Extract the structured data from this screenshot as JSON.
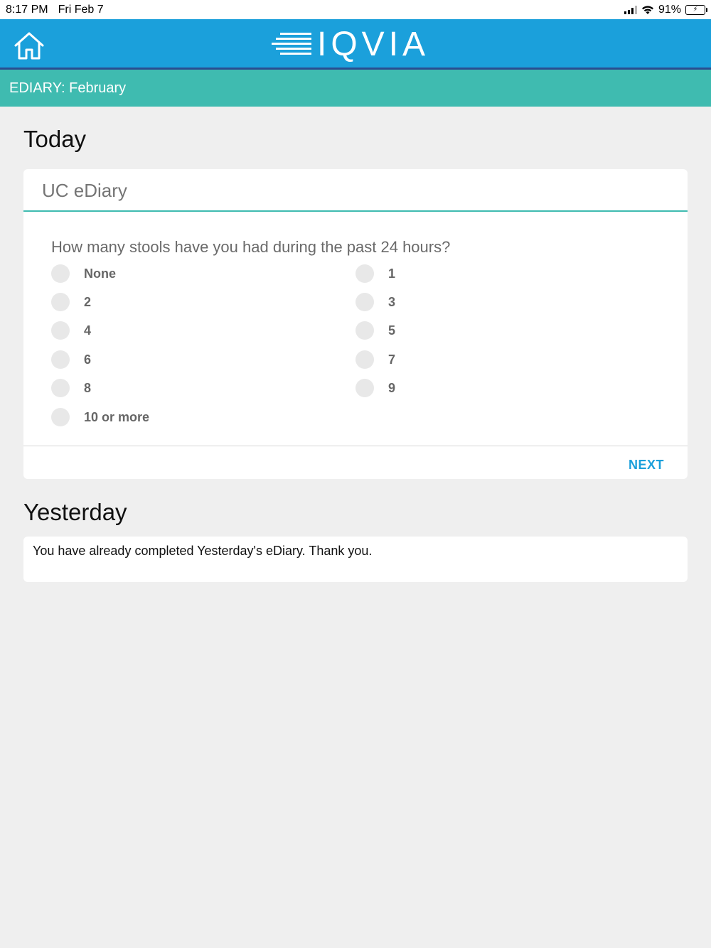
{
  "status_bar": {
    "time": "8:17 PM",
    "date": "Fri Feb 7",
    "battery_percent": "91%",
    "battery_level": 0.91
  },
  "header": {
    "logo_text": "IQVIA",
    "home_icon": "home-icon",
    "brand_color": "#1ba0db"
  },
  "sub_header": {
    "title": "EDIARY: February",
    "color": "#3fbbb0"
  },
  "today": {
    "section_title": "Today",
    "card_title": "UC eDiary",
    "question": "How many stools have you had during the past 24 hours?",
    "options": [
      "None",
      "1",
      "2",
      "3",
      "4",
      "5",
      "6",
      "7",
      "8",
      "9",
      "10 or more"
    ],
    "next_label": "NEXT"
  },
  "yesterday": {
    "section_title": "Yesterday",
    "message": "You have already completed Yesterday's eDiary. Thank you."
  }
}
